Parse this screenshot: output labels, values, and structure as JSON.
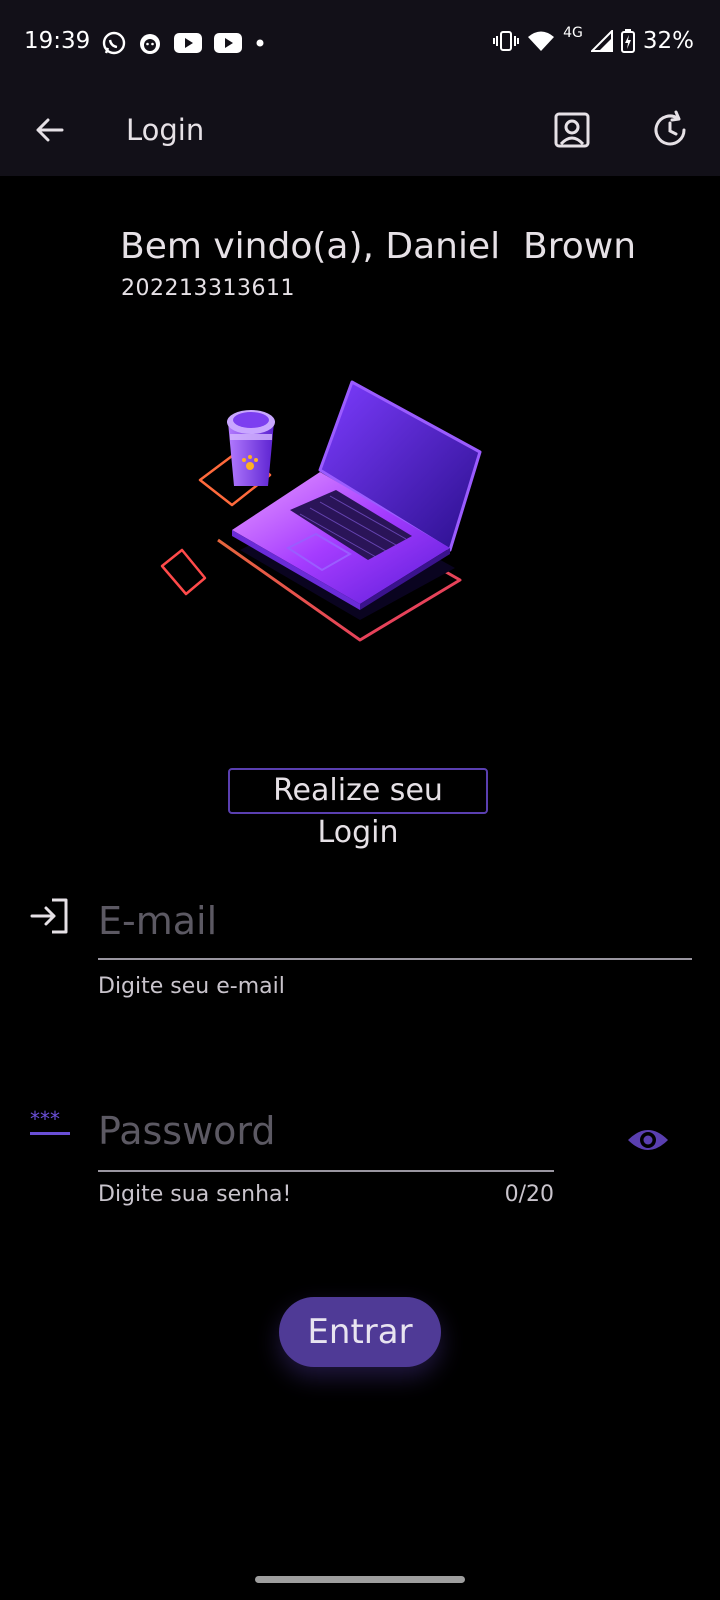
{
  "status_bar": {
    "time": "19:39",
    "left_icons": [
      "whatsapp-icon",
      "cat-app-icon",
      "youtube-icon",
      "youtube-icon",
      "dot-icon"
    ],
    "network_label": "4G",
    "battery": "32%"
  },
  "app_bar": {
    "title": "Login",
    "back_icon": "arrow-left-icon",
    "profile_icon": "account-box-icon",
    "refresh_icon": "history-icon"
  },
  "welcome": {
    "greeting": "Bem vindo(a), Daniel  Brown",
    "user_id": "202213313611"
  },
  "login_section": {
    "label": "Realize seu Login"
  },
  "email": {
    "placeholder": "E-mail",
    "value": "",
    "helper": "Digite seu e-mail",
    "icon": "login-icon"
  },
  "password": {
    "placeholder": "Password",
    "value": "",
    "helper": "Digite sua senha!",
    "counter": "0/20",
    "icon": "password-icon",
    "toggle_icon": "eye-icon"
  },
  "submit": {
    "label": "Entrar"
  },
  "colors": {
    "accent": "#5a3fb0",
    "button": "#4f3a96",
    "bar_background": "#121018"
  }
}
